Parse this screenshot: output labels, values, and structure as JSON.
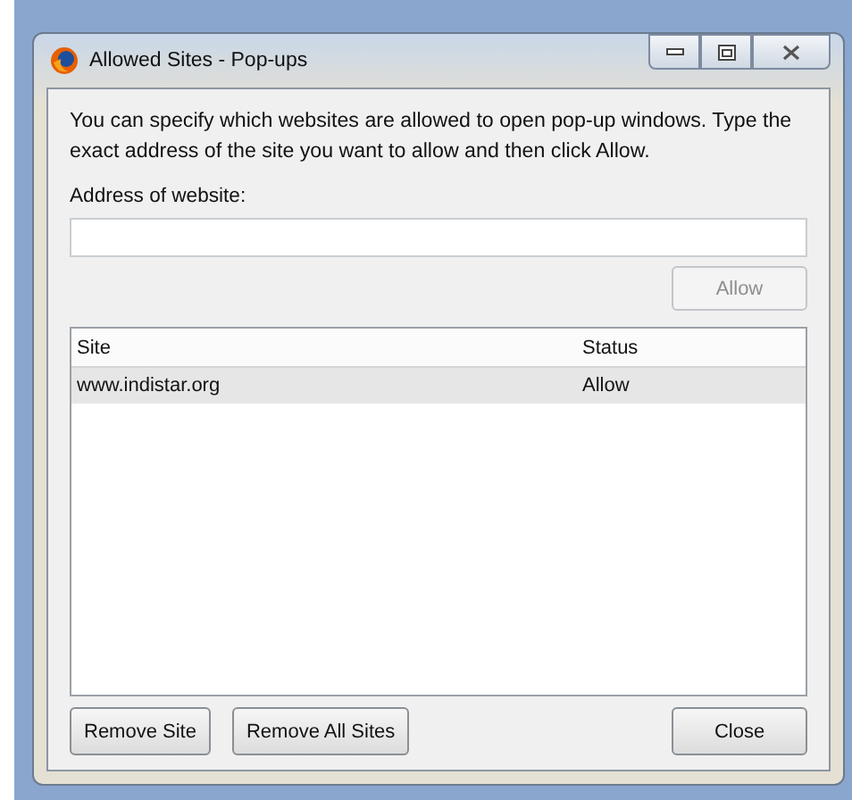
{
  "window": {
    "title": "Allowed Sites - Pop-ups"
  },
  "description": "You can specify which websites are allowed to open pop-up windows. Type the exact address of the site you want to allow and then click Allow.",
  "address_field": {
    "label": "Address of website:"
  },
  "allow_button": {
    "label": "Allow",
    "disabled": true
  },
  "table": {
    "columns": [
      "Site",
      "Status"
    ],
    "rows": [
      {
        "site": "www.indistar.org",
        "status": "Allow",
        "selected": true
      }
    ]
  },
  "buttons": [
    {
      "label": "Remove Site",
      "disabled": false
    },
    {
      "label": "Remove All Sites",
      "disabled": false
    },
    {
      "label": "Close",
      "disabled": false
    }
  ]
}
